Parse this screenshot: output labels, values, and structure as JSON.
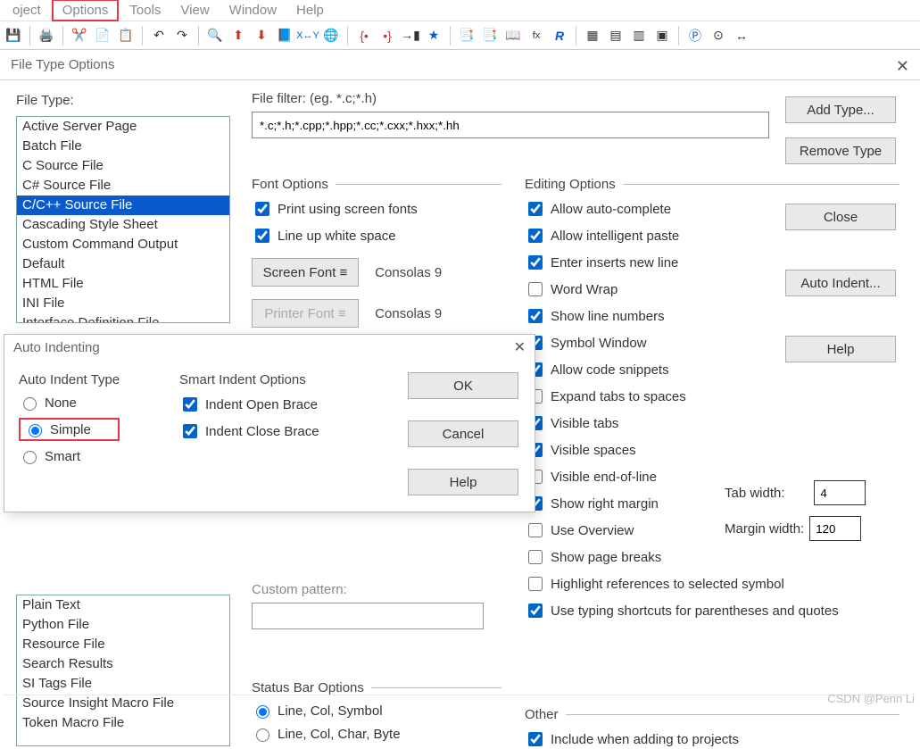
{
  "menubar": {
    "items": [
      "oject",
      "Options",
      "Tools",
      "View",
      "Window",
      "Help"
    ],
    "highlight_index": 1
  },
  "window": {
    "title": "File Type Options"
  },
  "file_type_label": "File Type:",
  "file_items_top": [
    "Active Server Page",
    "Batch File",
    "C Source File",
    "C# Source File",
    "C/C++ Source File",
    "Cascading Style Sheet",
    "Custom Command Output",
    "Default",
    "HTML File",
    "INI File",
    "Interface Definition File"
  ],
  "file_selected_index": 4,
  "file_items_bottom": [
    "Plain Text",
    "Python File",
    "Resource File",
    "Search Results",
    "SI Tags File",
    "Source Insight Macro File",
    "Token Macro File"
  ],
  "file_filter": {
    "label": "File filter: (eg. *.c;*.h)",
    "value": "*.c;*.h;*.cpp;*.hpp;*.cc;*.cxx;*.hxx;*.hh"
  },
  "right_buttons": {
    "add": "Add Type...",
    "remove": "Remove Type",
    "close": "Close",
    "auto_indent": "Auto Indent...",
    "help": "Help"
  },
  "font_options": {
    "title": "Font Options",
    "print": "Print using screen fonts",
    "lineup": "Line up white space",
    "screen_btn": "Screen Font  ≡",
    "printer_btn": "Printer Font  ≡",
    "screen_value": "Consolas 9",
    "printer_value": "Consolas 9"
  },
  "editing_options": {
    "title": "Editing Options",
    "items": [
      {
        "label": "Allow auto-complete",
        "chk": true
      },
      {
        "label": "Allow intelligent paste",
        "chk": true
      },
      {
        "label": "Enter inserts new line",
        "chk": true
      },
      {
        "label": "Word Wrap",
        "chk": false
      },
      {
        "label": "Show line numbers",
        "chk": true
      },
      {
        "label": "Symbol Window",
        "chk": true
      },
      {
        "label": "Allow code snippets",
        "chk": true
      },
      {
        "label": "Expand tabs to spaces",
        "chk": false
      },
      {
        "label": "Visible tabs",
        "chk": true
      },
      {
        "label": "Visible spaces",
        "chk": true
      },
      {
        "label": "Visible end-of-line",
        "chk": false
      },
      {
        "label": "Show right margin",
        "chk": true
      },
      {
        "label": "Use Overview",
        "chk": false
      },
      {
        "label": "Show page breaks",
        "chk": false
      },
      {
        "label": "Highlight references to selected symbol",
        "chk": false
      },
      {
        "label": "Use typing shortcuts for parentheses and quotes",
        "chk": true
      }
    ]
  },
  "tab": {
    "tabwidth_label": "Tab width:",
    "tabwidth": "4",
    "margin_label": "Margin width:",
    "margin": "120"
  },
  "custom_pattern": {
    "label": "Custom pattern:",
    "value": ""
  },
  "status_bar": {
    "title": "Status Bar Options",
    "opt1": "Line, Col, Symbol",
    "opt2": "Line, Col, Char, Byte"
  },
  "other": {
    "title": "Other",
    "include": "Include when adding to projects"
  },
  "ai": {
    "title": "Auto Indenting",
    "type_title": "Auto Indent Type",
    "none": "None",
    "simple": "Simple",
    "smart": "Smart",
    "smart_title": "Smart Indent Options",
    "open": "Indent Open Brace",
    "close_brace": "Indent Close Brace",
    "ok": "OK",
    "cancel": "Cancel",
    "help": "Help"
  },
  "watermark": "CSDN @Penn Li"
}
